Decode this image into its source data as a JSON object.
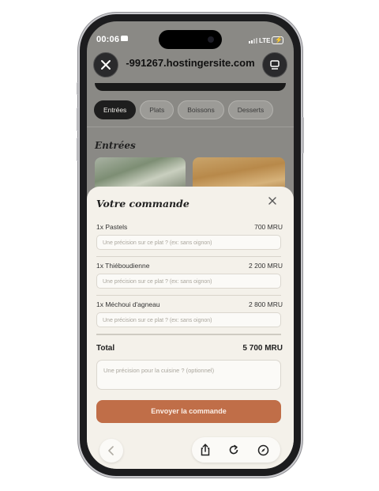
{
  "status": {
    "time": "00:06",
    "network": "LTE"
  },
  "browser": {
    "url": "-991267.hostingersite.com"
  },
  "menu": {
    "tabs": [
      {
        "label": "Entrées",
        "active": true
      },
      {
        "label": "Plats",
        "active": false
      },
      {
        "label": "Boissons",
        "active": false
      },
      {
        "label": "Desserts",
        "active": false
      }
    ],
    "section_title": "Entrées"
  },
  "order": {
    "title": "Votre commande",
    "items": [
      {
        "name": "1x Pastels",
        "price": "700 MRU",
        "note_placeholder": "Une précision sur ce plat ? (ex: sans oignon)"
      },
      {
        "name": "1x Thiéboudienne",
        "price": "2 200 MRU",
        "note_placeholder": "Une précision sur ce plat ? (ex: sans oignon)"
      },
      {
        "name": "1x Méchoui d'agneau",
        "price": "2 800 MRU",
        "note_placeholder": "Une précision sur ce plat ? (ex: sans oignon)"
      }
    ],
    "total_label": "Total",
    "total_value": "5 700 MRU",
    "kitchen_placeholder": "Une précision pour la cuisine ? (optionnel)",
    "send_label": "Envoyer la commande"
  },
  "icons": {
    "close": "close-icon",
    "tabs": "tabs-icon",
    "back": "chevron-left-icon",
    "share": "share-icon",
    "reload": "reload-icon",
    "compass": "compass-icon"
  },
  "colors": {
    "accent": "#c06e48",
    "sheet": "#f4f1ea",
    "active_tab": "#1e1e1e"
  }
}
